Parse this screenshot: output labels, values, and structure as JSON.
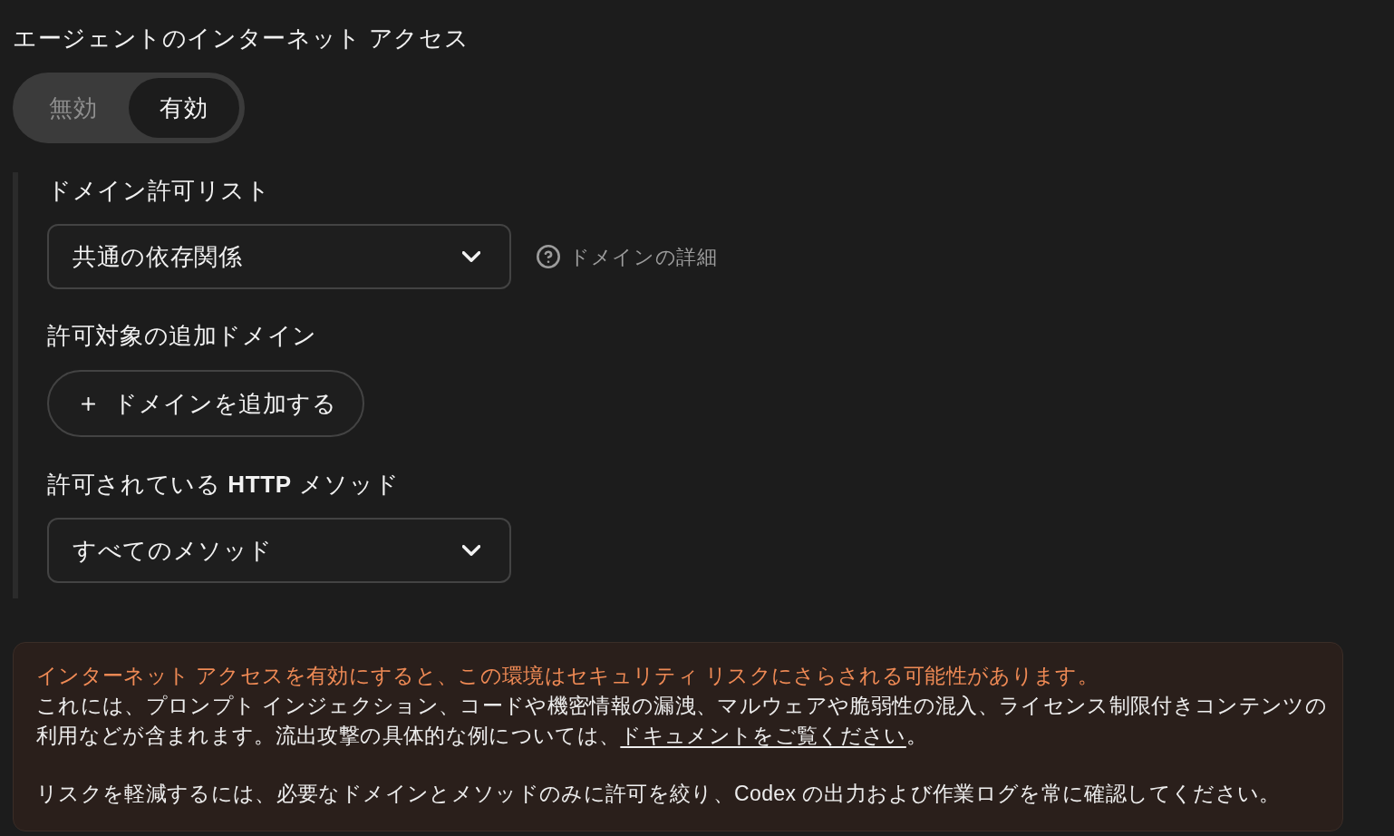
{
  "section_title": "エージェントのインターネット アクセス",
  "access_toggle": [
    {
      "label": "無効",
      "selected": false
    },
    {
      "label": "有効",
      "selected": true
    }
  ],
  "domain_allowlist": {
    "label": "ドメイン許可リスト",
    "value": "共通の依存関係",
    "help_link": "ドメインの詳細"
  },
  "additional_domains": {
    "label": "許可対象の追加ドメイン",
    "add_button": "ドメインを追加する"
  },
  "http_methods": {
    "label": "許可されている **HTTP** メソッド",
    "value": "すべてのメソッド"
  },
  "warning": {
    "headline": "インターネット アクセスを有効にすると、この環境はセキュリティ リスクにさらされる可能性があります。",
    "body": "これには、プロンプト インジェクション、コードや機密情報の漏洩、マルウェアや脆弱性の混入、ライセンス制限付きコンテンツの利用などが含まれます。流出攻撃の具体的な例については、",
    "link": "ドキュメントをご覧ください",
    "body_end": "。",
    "note": "リスクを軽減するには、必要なドメインとメソッドのみに許可を絞り、Codex の出力および作業ログを常に確認してください。"
  }
}
